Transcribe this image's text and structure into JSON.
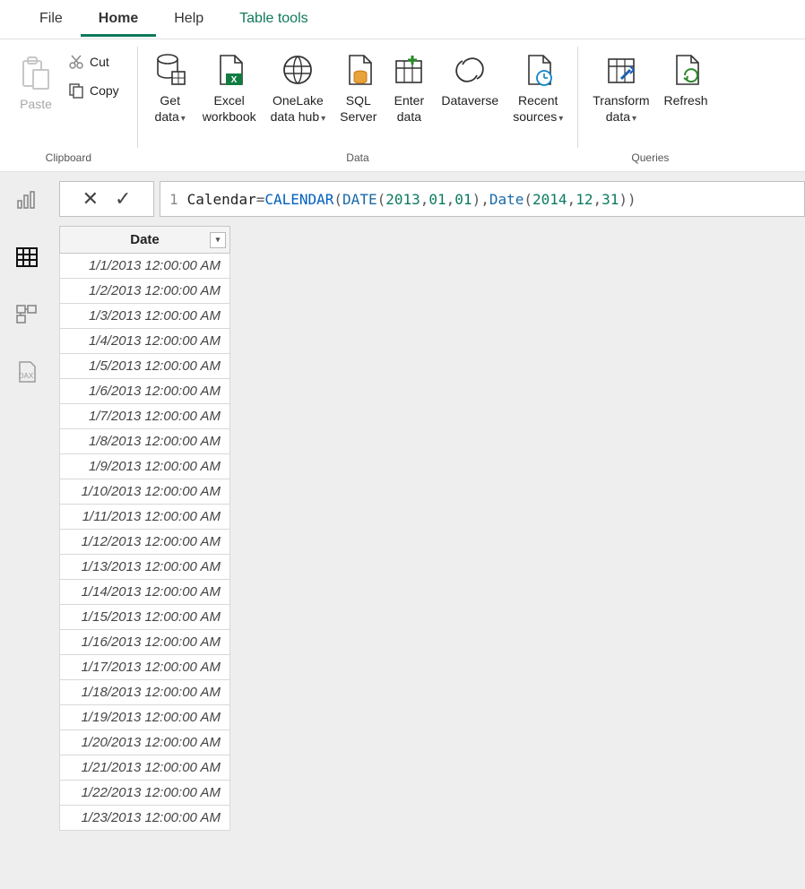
{
  "tabs": {
    "file": "File",
    "home": "Home",
    "help": "Help",
    "table_tools": "Table tools"
  },
  "ribbon": {
    "clipboard": {
      "label": "Clipboard",
      "paste": "Paste",
      "cut": "Cut",
      "copy": "Copy"
    },
    "data": {
      "label": "Data",
      "get_data": "Get\ndata",
      "excel": "Excel\nworkbook",
      "onelake": "OneLake\ndata hub",
      "sql": "SQL\nServer",
      "enter": "Enter\ndata",
      "dataverse": "Dataverse",
      "recent": "Recent\nsources"
    },
    "queries": {
      "label": "Queries",
      "transform": "Transform\ndata",
      "refresh": "Refresh"
    }
  },
  "rail": {
    "report": "report-view",
    "data": "data-view",
    "model": "model-view",
    "dax": "dax-view"
  },
  "formula": {
    "line": "1",
    "tokens": [
      "Calendar",
      " = ",
      "CALENDAR",
      "(",
      "DATE",
      "(",
      "2013",
      ",",
      "01",
      ",",
      "01",
      ")",
      ",",
      "Date",
      "(",
      "2014",
      ",",
      "12",
      ",",
      "31",
      ")",
      ")"
    ]
  },
  "table": {
    "header": "Date",
    "rows": [
      "1/1/2013 12:00:00 AM",
      "1/2/2013 12:00:00 AM",
      "1/3/2013 12:00:00 AM",
      "1/4/2013 12:00:00 AM",
      "1/5/2013 12:00:00 AM",
      "1/6/2013 12:00:00 AM",
      "1/7/2013 12:00:00 AM",
      "1/8/2013 12:00:00 AM",
      "1/9/2013 12:00:00 AM",
      "1/10/2013 12:00:00 AM",
      "1/11/2013 12:00:00 AM",
      "1/12/2013 12:00:00 AM",
      "1/13/2013 12:00:00 AM",
      "1/14/2013 12:00:00 AM",
      "1/15/2013 12:00:00 AM",
      "1/16/2013 12:00:00 AM",
      "1/17/2013 12:00:00 AM",
      "1/18/2013 12:00:00 AM",
      "1/19/2013 12:00:00 AM",
      "1/20/2013 12:00:00 AM",
      "1/21/2013 12:00:00 AM",
      "1/22/2013 12:00:00 AM",
      "1/23/2013 12:00:00 AM"
    ],
    "merged_pairs": [
      10,
      20
    ]
  }
}
